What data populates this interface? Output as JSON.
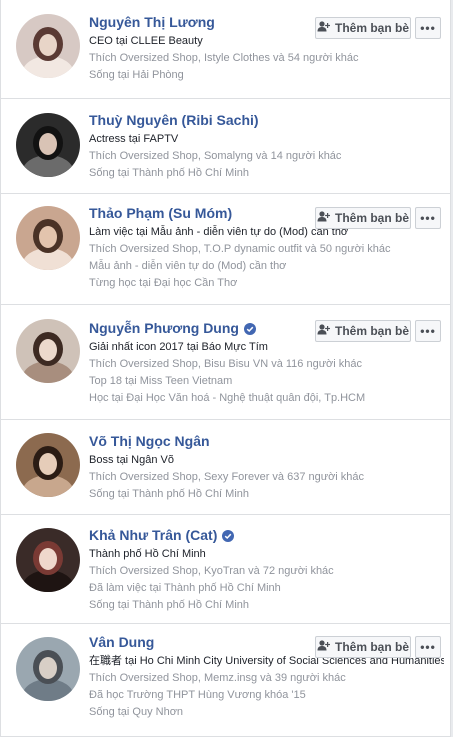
{
  "actions": {
    "add_friend_label": "Thêm bạn bè",
    "more_label": "•••"
  },
  "people": [
    {
      "name": "Nguyên Thị Lương",
      "verified": false,
      "lines": [
        "CEO tại CLLEE Beauty",
        "Thích Oversized Shop, Istyle Clothes và 54 người khác",
        "Sống tại Hải Phòng"
      ],
      "show_add_friend": true
    },
    {
      "name": "Thuỳ Nguyên (Ribi Sachi)",
      "verified": false,
      "lines": [
        "Actress tại FAPTV",
        "Thích Oversized Shop, Somalyng và 14 người khác",
        "Sống tại Thành phố Hồ Chí Minh"
      ],
      "show_add_friend": false
    },
    {
      "name": "Thảo Phạm (Su Móm)",
      "verified": false,
      "lines": [
        "Làm việc tại Mẫu ảnh - diễn viên tự do (Mod) cần thơ",
        "Thích Oversized Shop, T.O.P dynamic outfit và 50 người khác",
        "Mẫu ảnh - diễn viên tự do (Mod) cần thơ",
        "Từng học tại Đại học Cần Thơ"
      ],
      "show_add_friend": true
    },
    {
      "name": "Nguyễn Phương Dung",
      "verified": true,
      "lines": [
        "Giải nhất icon 2017 tại Báo Mực Tím",
        "Thích Oversized Shop, Bisu Bisu VN và 116 người khác",
        "Top 18 tại Miss Teen Vietnam",
        "Học tại Đại Học Văn hoá - Nghệ thuật quân đội, Tp.HCM"
      ],
      "show_add_friend": true
    },
    {
      "name": "Võ Thị Ngọc Ngân",
      "verified": false,
      "lines": [
        "Boss tại Ngân Võ",
        "Thích Oversized Shop, Sexy Forever và 637 người khác",
        "Sống tại Thành phố Hồ Chí Minh"
      ],
      "show_add_friend": false
    },
    {
      "name": "Khả Như Trân (Cat)",
      "verified": true,
      "lines": [
        "Thành phố Hồ Chí Minh",
        "Thích Oversized Shop, KyoTran và 72 người khác",
        "Đã làm việc tại Thành phố Hồ Chí Minh",
        "Sống tại Thành phố Hồ Chí Minh"
      ],
      "show_add_friend": false
    },
    {
      "name": "Vân Dung",
      "verified": false,
      "lines": [
        "在職者 tại Ho Chi Minh City University of Social Sciences and Humanities",
        "Thích Oversized Shop, Memz.insg và 39 người khác",
        "Đã học Trường THPT Hùng Vương khóa '15",
        "Sống tại Quy Nhơn"
      ],
      "show_add_friend": true
    }
  ],
  "colors": {
    "name_link": "#365899",
    "muted_text": "#90949c",
    "primary_text": "#1d2129",
    "verified_badge": "#4267b2"
  }
}
